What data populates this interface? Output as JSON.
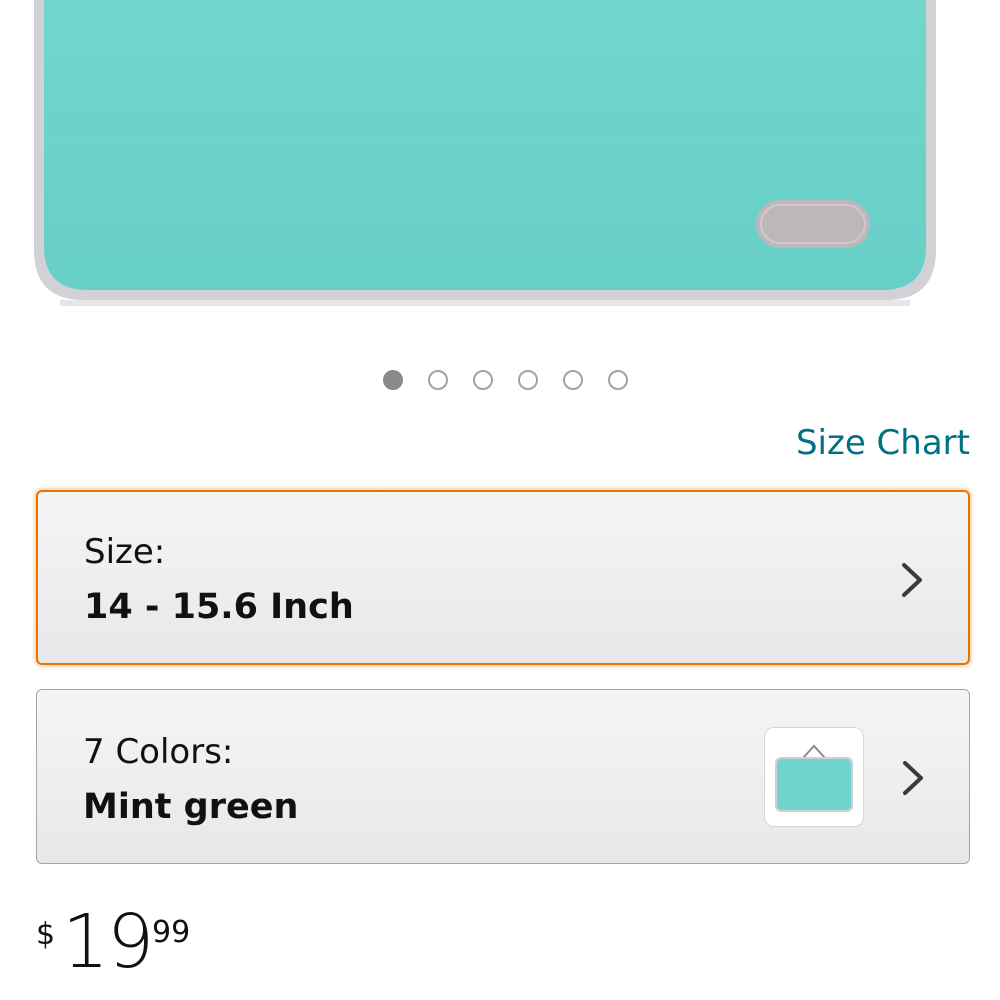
{
  "product_image": {
    "icon": "laptop-sleeve-photo",
    "colors": {
      "body": "#6ed3cb",
      "border": "#cfcfd3",
      "tag": "#bdb7bb"
    }
  },
  "carousel": {
    "total_images": 6,
    "active_index": 0
  },
  "size_chart": {
    "label": "Size Chart",
    "color": "#007185"
  },
  "size_selector": {
    "label": "Size:",
    "value": "14 - 15.6 Inch",
    "icon": "chevron-right-icon",
    "highlight_color": "#e77600"
  },
  "color_selector": {
    "label": "7 Colors:",
    "value": "Mint green",
    "swatch_icon": "mint-sleeve-thumbnail",
    "icon": "chevron-right-icon"
  },
  "price": {
    "symbol": "$",
    "whole": "19",
    "fraction": "99"
  }
}
